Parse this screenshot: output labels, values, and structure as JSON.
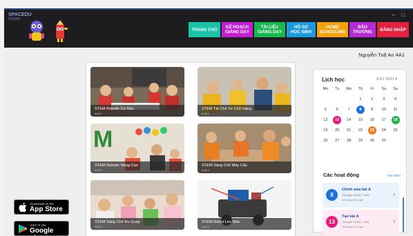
{
  "header": {
    "brand_top": "SPACEDU",
    "brand_sub": "STEAM",
    "window_minimize": "–",
    "window_maximize": "□"
  },
  "nav": [
    {
      "label": "TRANG CHỦ",
      "color": "#19c3a9"
    },
    {
      "label": "KẾ HOẠCH\nGIẢNG DẠY",
      "color": "#c51fd6"
    },
    {
      "label": "TÀI LIỆU\nGIẢNG DẠY",
      "color": "#17b84f"
    },
    {
      "label": "HỒ SƠ\nHỌC SINH",
      "color": "#1b9ae0"
    },
    {
      "label": "HOME\nSCHOOLING",
      "color": "#f4a20e"
    },
    {
      "label": "ĐẦU\nTRƯỜNG",
      "color": "#b62bd6"
    },
    {
      "label": "ĐĂNG NHẬP",
      "color": "#e3203e"
    }
  ],
  "user": {
    "name": "Nguyễn Tuệ An 4A1"
  },
  "courses": [
    {
      "title": "STEM Robotic Cơ Bản",
      "sub": "Khối 4"
    },
    {
      "title": "STEM Tái Chế Xe Chở Hàng",
      "sub": "Khối 3"
    },
    {
      "title": "STEM Robotic Nâng Cao",
      "sub": "Khối 5"
    },
    {
      "title": "STEM Sáng Chế Máy Cẩu",
      "sub": "Khối 4"
    },
    {
      "title": "STEM Sáng Chế Đu Quay",
      "sub": "Khối 3"
    },
    {
      "title": "STEM Robot Leo Nhà",
      "sub": "Khối 5"
    }
  ],
  "stores": [
    {
      "small": "Download on the",
      "big": "App Store",
      "icon": "apple-icon"
    },
    {
      "small": "GET IT ON",
      "big": "Google play",
      "icon": "google-play-icon"
    }
  ],
  "calendar": {
    "title": "Lịch học",
    "month": "JULY 2021 ▾",
    "weekdays": [
      "Mo",
      "Tu",
      "We",
      "Th",
      "Fr",
      "Sa",
      "Su"
    ],
    "leading_blanks": 3,
    "days": 31,
    "highlights": {
      "8": "#1e6fd9",
      "13": "#e6197a",
      "18": "#22b14c",
      "23": "#f07c22"
    }
  },
  "activities": {
    "title": "Các hoạt động",
    "more": "Xem thêm",
    "items": [
      {
        "num": "8",
        "name": "Chỉnh sửa bài A",
        "meta": "Thời gian  ● 8:AM - 9:AM",
        "desc": "Nội dung chỉ số giờ",
        "color": "#1e6fd9",
        "bg": "#eaf2fd"
      },
      {
        "num": "13",
        "name": "Tạo bài A",
        "meta": "Thời gian  ● 8:AM - 9:AM",
        "desc": "Nội dung chỉ số giờ",
        "color": "#e6197a",
        "bg": "#fdeaf3"
      }
    ]
  }
}
